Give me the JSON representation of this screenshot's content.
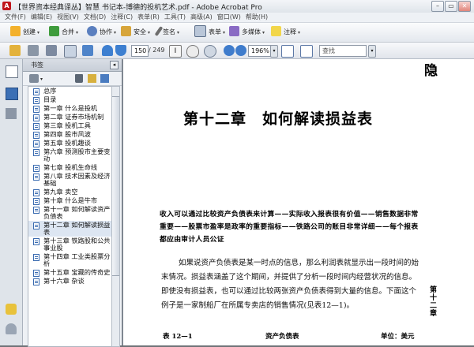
{
  "window": {
    "title": "【世界资本经典译丛】智慧 书记本-博德的投机艺术.pdf - Adobe Acrobat Pro",
    "minimize": "–",
    "restore": "▭",
    "close": "✕"
  },
  "menu": [
    "文件(F)",
    "编辑(E)",
    "视图(V)",
    "文档(D)",
    "注释(C)",
    "表单(R)",
    "工具(T)",
    "高级(A)",
    "窗口(W)",
    "帮助(H)"
  ],
  "toolbar": {
    "create": "创建",
    "combine": "合并",
    "collaborate": "协作",
    "secure": "安全",
    "sign": "签名",
    "forms": "表单",
    "multimedia": "多媒体",
    "comment": "注释"
  },
  "nav": {
    "page_current": "150",
    "page_total": "/ 249",
    "zoom": "196%",
    "find_placeholder": "查找"
  },
  "panel": {
    "title": "书签",
    "bookmarks": [
      {
        "label": "总序"
      },
      {
        "label": "目录"
      },
      {
        "label": "第一章 什么是投机"
      },
      {
        "label": "第二章 证券市场机制"
      },
      {
        "label": "第三章 投机工具"
      },
      {
        "label": "第四章 股市风波"
      },
      {
        "label": "第五章 投机趣谈"
      },
      {
        "label": "第六章 预测股市主要变动"
      },
      {
        "label": "第七章 投机生命线"
      },
      {
        "label": "第八章 技术因素及经济基础"
      },
      {
        "label": "第九章 卖空"
      },
      {
        "label": "第十章 什么是牛市"
      },
      {
        "label": "第十一章 如何解读资产负债表"
      },
      {
        "label": "第十二章 如何解读损益表"
      },
      {
        "label": "第十三章 铁路股和公共事业股"
      },
      {
        "label": "第十四章 工业类股票分析"
      },
      {
        "label": "第十五章 宝藏的传奇史"
      },
      {
        "label": "第十六章 杂谈"
      }
    ]
  },
  "document": {
    "corner_mark": "隐",
    "chapter_title": "第十二章　如何解读损益表",
    "lead": "收入可以通过比较资产负债表来计算——实际收入报表很有价值——销售数据非常重要——股票市盈率是政率的重要指标——铁路公司的账目非常详细——每个报表都应由审计人员公证",
    "body": "如果说资产负债表是某一时点的信息，那么利润表就显示出一段时间的始末情况。损益表涵盖了这个期间，并提供了分析一段时间内经营状况的信息。即使没有损益表，也可以通过比较两张资产负债表得到大量的信息。下面这个例子是一家制船厂在所属专卖店的销售情况(见表12—1)。",
    "table_label": "表 12—1",
    "table_title": "资产负债表",
    "table_unit": "单位：美元",
    "side_title": "第十二章"
  }
}
